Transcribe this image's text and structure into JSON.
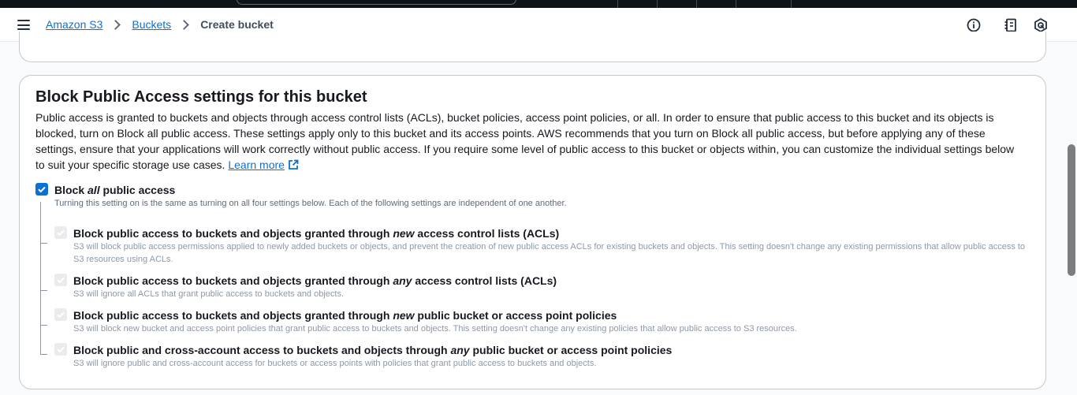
{
  "breadcrumb": {
    "items": [
      {
        "label": "Amazon S3"
      },
      {
        "label": "Buckets"
      }
    ],
    "current": "Create bucket"
  },
  "icons": {
    "menu": "hamburger-menu-icon",
    "info": "info-circle-icon",
    "notes": "notes-panel-icon",
    "settings": "hexagon-settings-icon",
    "external": "external-link-icon",
    "check": "checkmark-icon"
  },
  "section": {
    "title": "Block Public Access settings for this bucket",
    "description": "Public access is granted to buckets and objects through access control lists (ACLs), bucket policies, access point policies, or all. In order to ensure that public access to this bucket and its objects is blocked, turn on Block all public access. These settings apply only to this bucket and its access points. AWS recommends that you turn on Block all public access, but before applying any of these settings, ensure that your applications will work correctly without public access. If you require some level of public access to this bucket or objects within, you can customize the individual settings below to suit your specific storage use cases.",
    "learn_more": "Learn more"
  },
  "block_all": {
    "label_pre": "Block ",
    "label_em": "all",
    "label_post": " public access",
    "checked": true,
    "description": "Turning this setting on is the same as turning on all four settings below. Each of the following settings are independent of one another."
  },
  "settings": [
    {
      "label_pre": "Block public access to buckets and objects granted through ",
      "label_em": "new",
      "label_post": " access control lists (ACLs)",
      "checked": true,
      "disabled": true,
      "description": "S3 will block public access permissions applied to newly added buckets or objects, and prevent the creation of new public access ACLs for existing buckets and objects. This setting doesn't change any existing permissions that allow public access to S3 resources using ACLs."
    },
    {
      "label_pre": "Block public access to buckets and objects granted through ",
      "label_em": "any",
      "label_post": " access control lists (ACLs)",
      "checked": true,
      "disabled": true,
      "description": "S3 will ignore all ACLs that grant public access to buckets and objects."
    },
    {
      "label_pre": "Block public access to buckets and objects granted through ",
      "label_em": "new",
      "label_post": " public bucket or access point policies",
      "checked": true,
      "disabled": true,
      "description": "S3 will block new bucket and access point policies that grant public access to buckets and objects. This setting doesn't change any existing policies that allow public access to S3 resources."
    },
    {
      "label_pre": "Block public and cross-account access to buckets and objects through ",
      "label_em": "any",
      "label_post": " public bucket or access point policies",
      "checked": true,
      "disabled": true,
      "description": "S3 will ignore public and cross-account access for buckets or access points with policies that grant public access to buckets and objects."
    }
  ],
  "colors": {
    "accent": "#0972d3",
    "topbar": "#0f141a",
    "disabled_check": "#e9ebed"
  }
}
